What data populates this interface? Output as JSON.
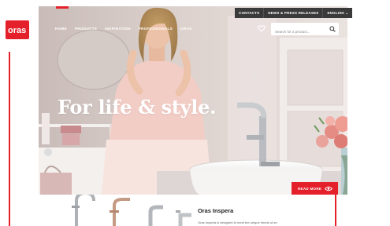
{
  "brand": {
    "logo_text": "oras",
    "accent": "#e4202b"
  },
  "topbar": {
    "items": [
      "CONTACTS",
      "NEWS & PRESS RELEASES",
      "ENGLISH ⌄"
    ]
  },
  "nav": {
    "items": [
      "HOME",
      "PRODUCTS",
      "INSPIRATION",
      "PROFESSIONALS",
      "ORAS"
    ]
  },
  "search": {
    "placeholder": "Search for a product..."
  },
  "hero": {
    "headline": "For life & style.",
    "read_more": "READ MORE"
  },
  "product": {
    "title": "Oras Inspera",
    "description": "Oras Inspera is designed to meet the unique needs of an"
  }
}
